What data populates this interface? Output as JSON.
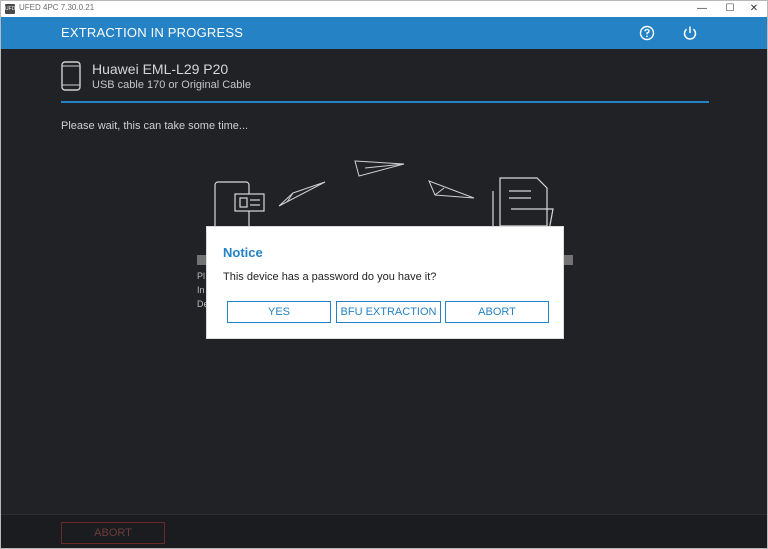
{
  "window": {
    "title": "UFED 4PC 7.30.0.21",
    "app_icon": "UFD"
  },
  "header": {
    "title": "EXTRACTION IN PROGRESS",
    "help_icon": "help-icon",
    "power_icon": "power-icon"
  },
  "device": {
    "name": "Huawei EML-L29 P20",
    "connection": "USB cable 170 or Original Cable"
  },
  "status": {
    "wait_text": "Please wait, this can take some time...",
    "partial_lines": [
      "Pl",
      "In",
      "De"
    ]
  },
  "dialog": {
    "title": "Notice",
    "message": "This device has a password do you have it?",
    "buttons": {
      "yes": "YES",
      "bfu": "BFU EXTRACTION",
      "abort": "ABORT"
    }
  },
  "footer": {
    "abort_label": "ABORT"
  },
  "colors": {
    "accent": "#2582c4",
    "background": "#202226",
    "dialog_bg": "#ffffff"
  }
}
